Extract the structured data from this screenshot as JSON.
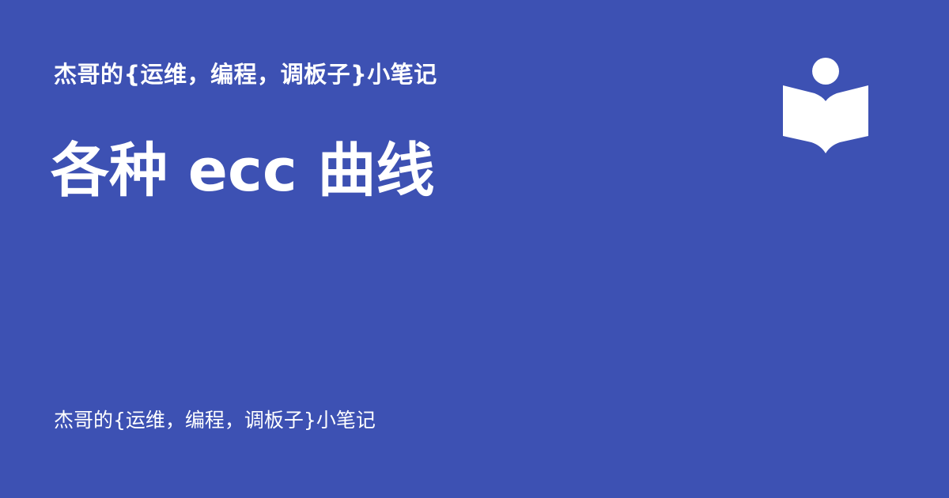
{
  "header": {
    "site_name": "杰哥的{运维，编程，调板子}小笔记"
  },
  "main": {
    "title": "各种 ecc 曲线"
  },
  "footer": {
    "site_name": "杰哥的{运维，编程，调板子}小笔记"
  },
  "logo": {
    "icon": "book-reader-icon",
    "color": "#ffffff"
  },
  "colors": {
    "background": "#3d51b3",
    "text": "#ffffff"
  }
}
